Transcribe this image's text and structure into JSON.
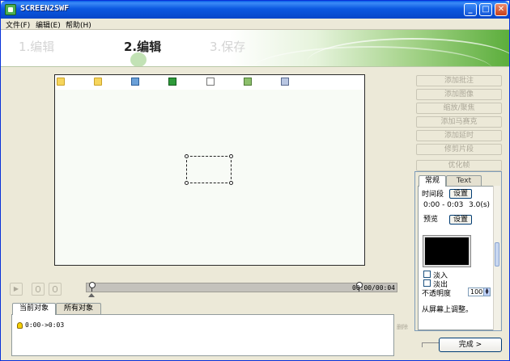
{
  "window": {
    "title": "SCREEN2SWF",
    "minimize": "_",
    "maximize": "□",
    "close": "✕"
  },
  "menu": [
    {
      "label": "文件(F)"
    },
    {
      "label": "编辑(E)"
    },
    {
      "label": "帮助(H)"
    }
  ],
  "steps": [
    {
      "label": "1.编辑",
      "state": "dim"
    },
    {
      "label": "2.编辑",
      "state": "active"
    },
    {
      "label": "3.保存",
      "state": "dim"
    }
  ],
  "right_buttons": [
    {
      "label": "添加批注"
    },
    {
      "label": "添加图像"
    },
    {
      "label": "缩放/聚焦"
    },
    {
      "label": "添加马赛克"
    },
    {
      "label": "添加延时"
    },
    {
      "label": "修剪片段"
    },
    {
      "label": "优化帧"
    }
  ],
  "properties": {
    "tabs": [
      {
        "label": "常规"
      },
      {
        "label": "Text"
      }
    ],
    "time_segment_label": "时间段",
    "set_button": "设置",
    "time_range": "0:00 - 0:03",
    "duration": "3.0(s)",
    "preview_label": "预览",
    "preview_set_button": "设置",
    "fade_in": "淡入",
    "fade_out": "淡出",
    "opacity_label": "不透明度",
    "opacity_value": "100",
    "hint": "从屏幕上调整。"
  },
  "playback": {
    "play_icon": "▶",
    "timeline_end_time": "00:00/00:04"
  },
  "objects": {
    "tabs": [
      {
        "label": "当前对象"
      },
      {
        "label": "所有对象"
      }
    ],
    "items": [
      {
        "label": "0:00->0:03"
      }
    ],
    "delete_label": "删除"
  },
  "footer": {
    "finish_button": "完成 >"
  },
  "colors": {
    "title_bar": "#0a5ee8",
    "banner_green": "#5cae3c",
    "preview_background": "#000000"
  }
}
